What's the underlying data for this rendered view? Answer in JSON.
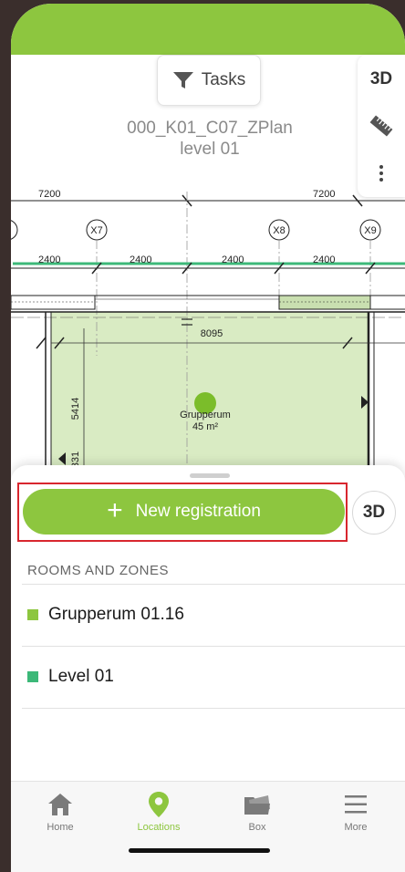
{
  "plan": {
    "tasks_label": "Tasks",
    "title": "000_K01_C07_ZPlan",
    "subtitle": "level 01",
    "toolbar_3d": "3D",
    "dims": {
      "top_left": "7200",
      "top_right": "7200",
      "grid_x7": "X7",
      "grid_x8": "X8",
      "grid_x9": "X9",
      "dim_2400_a": "2400",
      "dim_2400_b": "2400",
      "dim_2400_c": "2400",
      "dim_2400_d": "2400",
      "room_width": "8095",
      "room_height": "5414",
      "partial_dim": "331"
    },
    "room": {
      "name": "Grupperum",
      "area": "45 m²"
    }
  },
  "sheet": {
    "new_registration": "New registration",
    "btn_3d": "3D",
    "section_title": "ROOMS AND ZONES",
    "items": [
      {
        "label": "Grupperum 01.16",
        "color": "#8dc63f"
      },
      {
        "label": "Level 01",
        "color": "#3cb878"
      }
    ]
  },
  "tabs": [
    {
      "label": "Home",
      "icon": "home-icon",
      "active": false
    },
    {
      "label": "Locations",
      "icon": "map-pin-icon",
      "active": true
    },
    {
      "label": "Box",
      "icon": "folder-icon",
      "active": false
    },
    {
      "label": "More",
      "icon": "menu-icon",
      "active": false
    }
  ],
  "colors": {
    "accent": "#8dc63f",
    "highlight": "#d8262e"
  }
}
